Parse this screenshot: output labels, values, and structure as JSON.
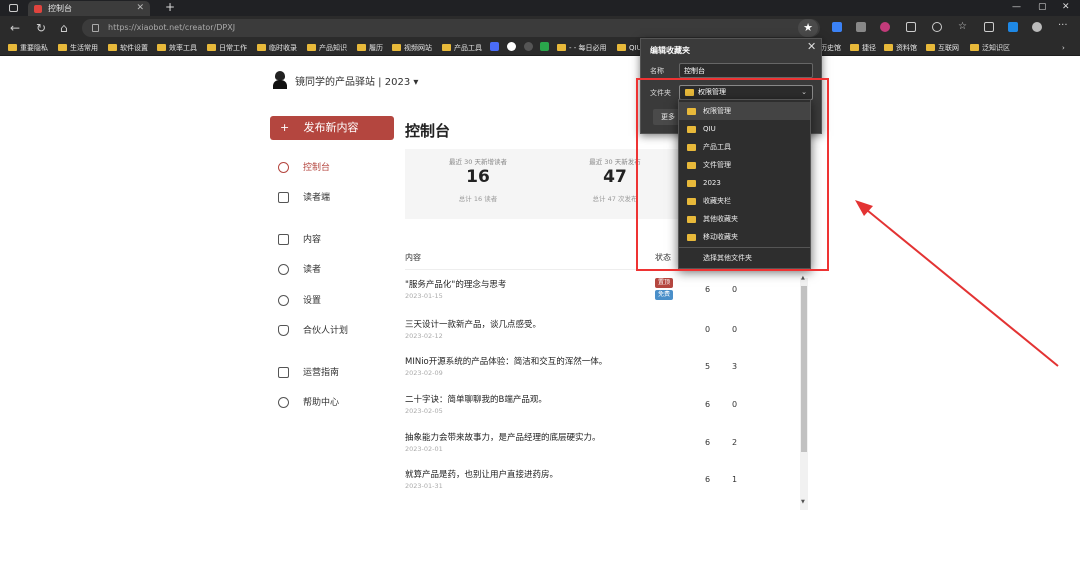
{
  "browser": {
    "tab_title": "控制台",
    "url": "https://xiaobot.net/creator/DPXJ",
    "bookmarks": [
      "重要隐私",
      "生活常用",
      "软件设置",
      "效率工具",
      "日常工作",
      "临时收录",
      "产品知识",
      "履历",
      "视频网站",
      "产品工具",
      "- - 每日必用",
      "QIU",
      "历史馆",
      "捷径",
      "资料馆",
      "互联网",
      "泛知识区"
    ]
  },
  "site": {
    "name": "镜同学的产品驿站 | 2023 ▾"
  },
  "sidebar": {
    "publish_label": "发布新内容",
    "items": [
      {
        "label": "控制台"
      },
      {
        "label": "读者端"
      },
      {
        "label": "内容"
      },
      {
        "label": "读者"
      },
      {
        "label": "设置"
      },
      {
        "label": "合伙人计划"
      },
      {
        "label": "运营指南"
      },
      {
        "label": "帮助中心"
      }
    ]
  },
  "main": {
    "title": "控制台",
    "stats": [
      {
        "label": "最近 30 天新增读者",
        "value": "16",
        "sub": "总计 16 读者"
      },
      {
        "label": "最近 30 天新发布",
        "value": "47",
        "sub": "总计 47 次发布"
      }
    ],
    "table": {
      "col_content": "内容",
      "col_status": "状态",
      "rows": [
        {
          "title": "\"服务产品化\"的理念与思考",
          "date": "2023-01-15",
          "n1": "6",
          "n2": "0",
          "badges": [
            "置顶",
            "免费"
          ]
        },
        {
          "title": "三天设计一款新产品，谈几点感受。",
          "date": "2023-02-12",
          "n1": "0",
          "n2": "0",
          "badges": []
        },
        {
          "title": "MINio开源系统的产品体验：简洁和交互的浑然一体。",
          "date": "2023-02-09",
          "n1": "5",
          "n2": "3",
          "badges": []
        },
        {
          "title": "二十字诀：简单聊聊我的B端产品观。",
          "date": "2023-02-05",
          "n1": "6",
          "n2": "0",
          "badges": []
        },
        {
          "title": "抽象能力会带来故事力，是产品经理的底层硬实力。",
          "date": "2023-02-01",
          "n1": "6",
          "n2": "2",
          "badges": []
        },
        {
          "title": "就算产品是药，也别让用户直接进药房。",
          "date": "2023-01-31",
          "n1": "6",
          "n2": "1",
          "badges": []
        }
      ]
    }
  },
  "favorites_popup": {
    "title": "编辑收藏夹",
    "name_label": "名称",
    "name_value": "控制台",
    "folder_label": "文件夹",
    "folder_selected": "权限管理",
    "more_label": "更多",
    "options": [
      "权限管理",
      "QIU",
      "产品工具",
      "文件管理",
      "2023",
      "收藏夹栏",
      "其他收藏夹",
      "移动收藏夹"
    ],
    "other_label": "选择其他文件夹"
  },
  "colors": {
    "accent": "#b4463f",
    "annotation": "#e33333",
    "folder": "#e8b93a"
  }
}
